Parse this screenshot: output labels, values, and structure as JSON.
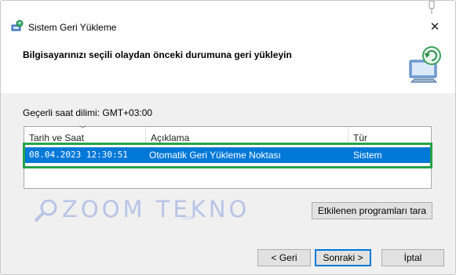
{
  "window": {
    "title": "Sistem Geri Yükleme",
    "close_symbol": "✕"
  },
  "header": {
    "heading": "Bilgisayarınızı seçili olaydan önceki durumuna geri yükleyin"
  },
  "timezone_label": "Geçerli saat dilimi: GMT+03:00",
  "table": {
    "columns": [
      {
        "label": "Tarih ve Saat"
      },
      {
        "label": "Açıklama"
      },
      {
        "label": "Tür"
      }
    ],
    "rows": [
      {
        "date": "08.04.2023 12:30:51",
        "description": "Otomatik Geri Yükleme Noktası",
        "type": "Sistem",
        "selected": true
      }
    ]
  },
  "buttons": {
    "scan": "Etkilenen programları tara",
    "back": "< Geri",
    "next": "Sonraki >",
    "cancel": "İptal"
  },
  "watermark": {
    "text": "ZOOM TEKNO",
    "sub": ".COM"
  },
  "colors": {
    "selection": "#0078d7",
    "highlight_border": "#27a24a",
    "body_bg": "#f0f0f0"
  },
  "icons": {
    "app": "system-restore-icon",
    "header_art": "system-restore-computer-icon",
    "close": "close-icon"
  }
}
